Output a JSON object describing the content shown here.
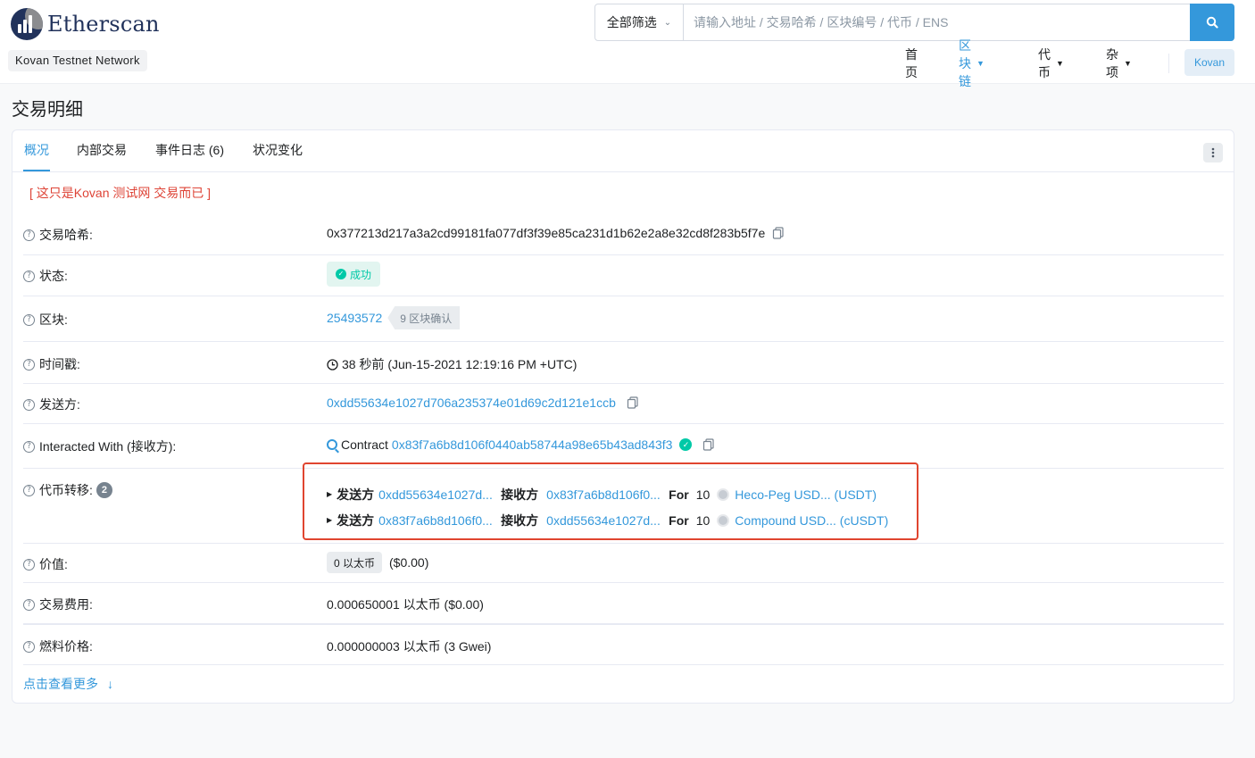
{
  "header": {
    "logo_text": "Etherscan",
    "network": "Kovan Testnet Network",
    "search": {
      "filter_label": "全部筛选",
      "placeholder": "请输入地址 / 交易哈希 / 区块编号 / 代币 / ENS"
    },
    "nav": {
      "home": "首页",
      "blockchain": "区块链",
      "tokens": "代币",
      "misc": "杂项",
      "network_button": "Kovan"
    }
  },
  "page": {
    "title": "交易明细"
  },
  "tabs": {
    "overview": "概况",
    "internal": "内部交易",
    "logs": "事件日志 (6)",
    "state": "状况变化"
  },
  "warning": "[ 这只是Kovan 测试网 交易而已 ]",
  "details": {
    "hash": {
      "label": "交易哈希:",
      "value": "0x377213d217a3a2cd99181fa077df3f39e85ca231d1b62e2a8e32cd8f283b5f7e"
    },
    "status": {
      "label": "状态:",
      "value": "成功"
    },
    "block": {
      "label": "区块:",
      "value": "25493572",
      "confirmations": "9 区块确认"
    },
    "timestamp": {
      "label": "时间戳:",
      "value": "38 秒前 (Jun-15-2021 12:19:16 PM +UTC)"
    },
    "from": {
      "label": "发送方:",
      "value": "0xdd55634e1027d706a235374e01d69c2d121e1ccb"
    },
    "to": {
      "label": "Interacted With (接收方):",
      "prefix": "Contract",
      "value": "0x83f7a6b8d106f0440ab58744a98e65b43ad843f3"
    },
    "token_transfers": {
      "label": "代币转移:",
      "count": "2",
      "items": [
        {
          "from_label": "发送方",
          "from": "0xdd55634e1027d...",
          "to_label": "接收方",
          "to": "0x83f7a6b8d106f0...",
          "for_label": "For",
          "amount": "10",
          "token": "Heco-Peg USD... (USDT)"
        },
        {
          "from_label": "发送方",
          "from": "0x83f7a6b8d106f0...",
          "to_label": "接收方",
          "to": "0xdd55634e1027d...",
          "for_label": "For",
          "amount": "10",
          "token": "Compound USD... (cUSDT)"
        }
      ]
    },
    "value": {
      "label": "价值:",
      "eth": "0 以太币",
      "usd": "($0.00)"
    },
    "fee": {
      "label": "交易费用:",
      "value": "0.000650001 以太币 ($0.00)"
    },
    "gas_price": {
      "label": "燃料价格:",
      "value": "0.000000003 以太币 (3 Gwei)"
    }
  },
  "more_link": "点击查看更多",
  "icons": {
    "help": "question-circle-icon",
    "copy": "copy-icon",
    "search": "search-icon",
    "more": "vertical-dots-icon"
  },
  "colors": {
    "accent": "#3498db",
    "success": "#00c9a7",
    "warning": "#de4437",
    "highlight": "#e0452f"
  }
}
